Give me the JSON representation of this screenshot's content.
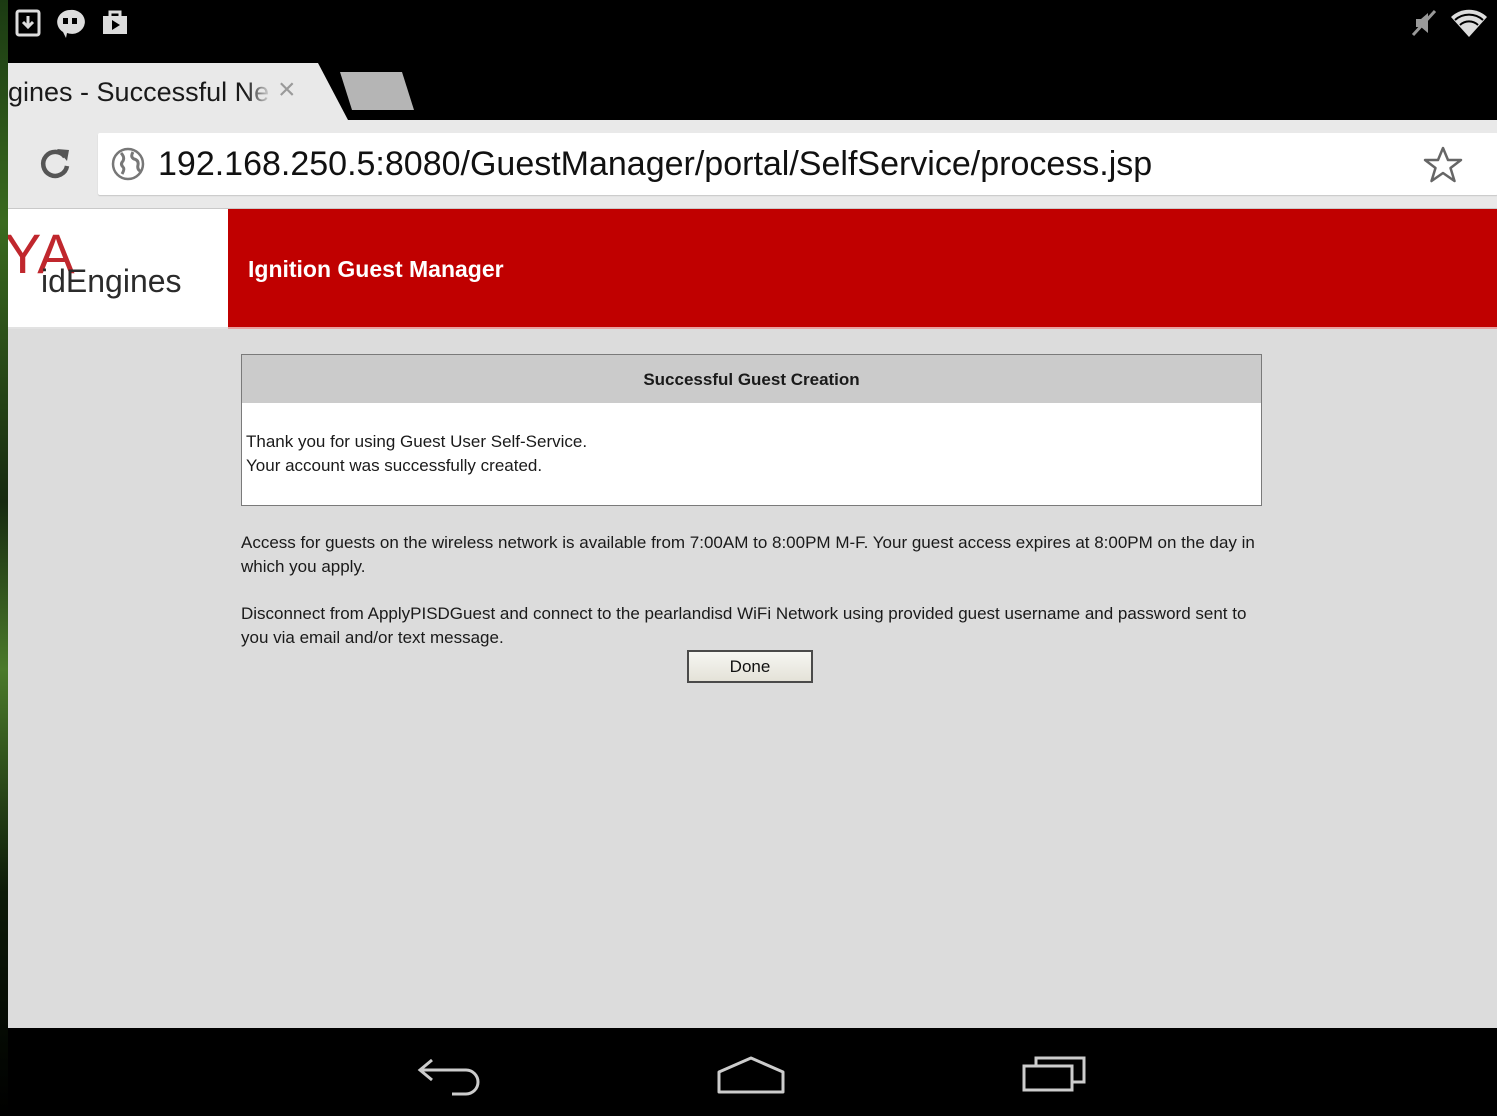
{
  "browser": {
    "tab_title": "gines - Successful Ne",
    "tab_close": "×",
    "url": "192.168.250.5:8080/GuestManager/portal/SelfService/process.jsp"
  },
  "page": {
    "logo_mark": "YA",
    "logo_text": "idEngines",
    "banner_title": "Ignition Guest Manager",
    "panel": {
      "title": "Successful Guest Creation",
      "line1": "Thank you for using Guest User Self-Service.",
      "line2": "Your account was successfully created."
    },
    "access_info": "Access for guests on the wireless network is available from 7:00AM to 8:00PM M-F. Your guest access expires at 8:00PM on the day in which you apply.",
    "disconnect_info": "Disconnect from ApplyPISDGuest and connect to the pearlandisd WiFi Network using provided guest username and password sent to you via email and/or text message.",
    "done_label": "Done"
  },
  "icons": {
    "status_left": [
      "download-icon",
      "hangouts-icon",
      "play-store-icon"
    ],
    "status_right": [
      "muted-icon",
      "wifi-icon"
    ],
    "toolbar": [
      "reload-icon",
      "globe-icon",
      "star-icon"
    ],
    "nav": [
      "back-icon",
      "home-icon",
      "recents-icon"
    ]
  },
  "colors": {
    "banner": "#c00000",
    "page_bg": "#dcdcdc",
    "logo_red": "#c0272d"
  }
}
